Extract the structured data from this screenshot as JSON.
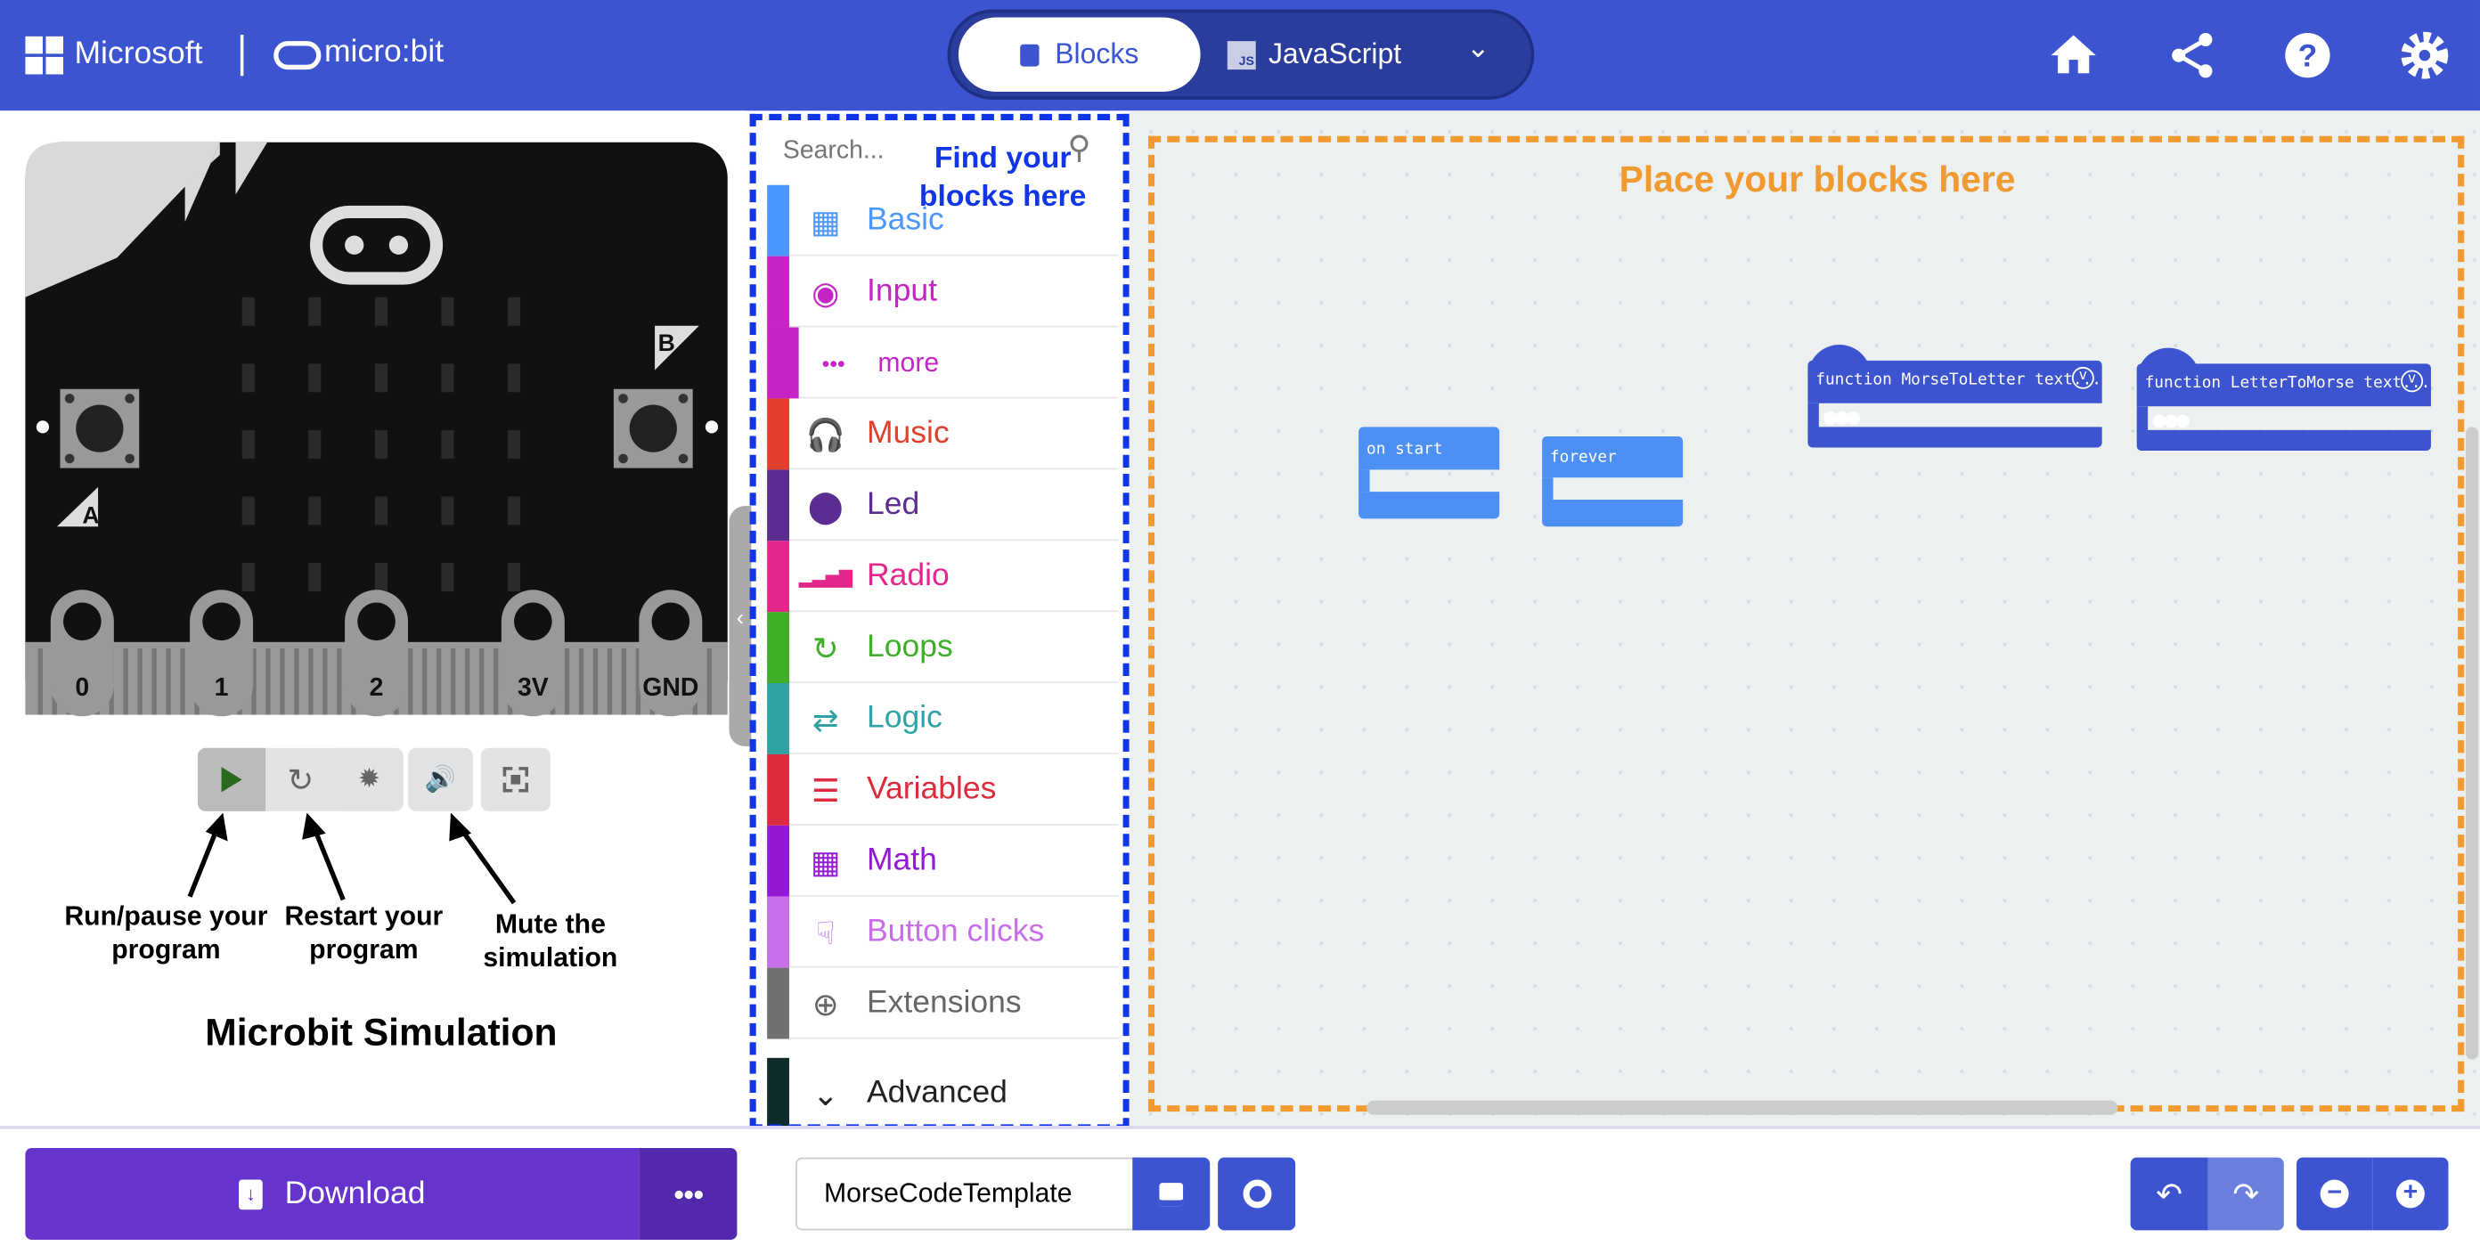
{
  "header": {
    "brand": "Microsoft",
    "product": "micro:bit",
    "tabs": [
      {
        "label": "Blocks",
        "active": true
      },
      {
        "label": "JavaScript",
        "badge": "JS"
      }
    ],
    "icons": [
      "home-icon",
      "share-icon",
      "help-icon",
      "settings-icon"
    ],
    "color": "#3c54cf"
  },
  "simulator": {
    "pins": [
      "0",
      "1",
      "2",
      "3V",
      "GND"
    ],
    "buttons": [
      "A",
      "B"
    ],
    "controls": [
      "play-icon",
      "restart-icon",
      "debug-icon",
      "sound-icon",
      "fullscreen-icon"
    ],
    "annotations": {
      "run": "Run/pause your program",
      "restart": "Restart your program",
      "mute": "Mute the simulation"
    },
    "title": "Microbit Simulation"
  },
  "toolbox": {
    "search_placeholder": "Search...",
    "annotation": "Find your blocks here",
    "categories": [
      {
        "label": "Basic",
        "color": "#4c97ff",
        "icon": "grid-icon"
      },
      {
        "label": "Input",
        "color": "#c724c7",
        "icon": "target-icon"
      },
      {
        "label": "more",
        "color": "#c724c7",
        "icon": "ellipsis-icon"
      },
      {
        "label": "Music",
        "color": "#e0402c",
        "icon": "headphones-icon"
      },
      {
        "label": "Led",
        "color": "#5c2d91",
        "icon": "toggle-icon"
      },
      {
        "label": "Radio",
        "color": "#e3268c",
        "icon": "signal-icon"
      },
      {
        "label": "Loops",
        "color": "#3fae29",
        "icon": "loop-icon"
      },
      {
        "label": "Logic",
        "color": "#2fa3a4",
        "icon": "shuffle-icon"
      },
      {
        "label": "Variables",
        "color": "#dc2b3c",
        "icon": "list-icon"
      },
      {
        "label": "Math",
        "color": "#9419d3",
        "icon": "calculator-icon"
      },
      {
        "label": "Button clicks",
        "color": "#c86ee8",
        "icon": "pointer-icon"
      },
      {
        "label": "Extensions",
        "color": "#717171",
        "icon": "plus-circle-icon"
      },
      {
        "label": "Advanced",
        "color": "#0f2b2b",
        "icon": "chevron-down-icon"
      }
    ]
  },
  "workspace": {
    "annotation": "Place your blocks here",
    "blocks": {
      "on_start": "on start",
      "forever": "forever",
      "f1": "function MorseToLetter text...",
      "f2": "function LetterToMorse text..."
    }
  },
  "bottom": {
    "download": "Download",
    "project_name": "MorseCodeTemplate"
  }
}
